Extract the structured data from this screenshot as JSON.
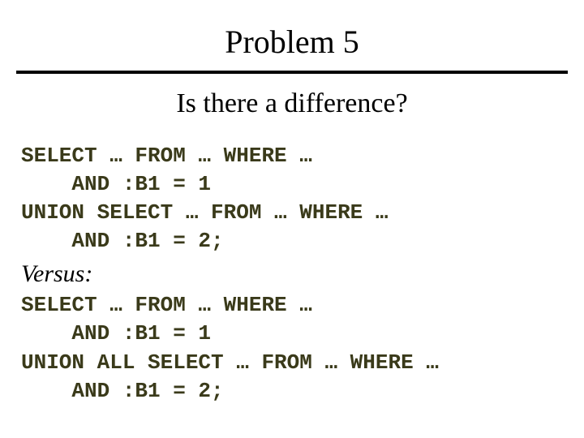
{
  "title": "Problem 5",
  "subtitle": "Is there a difference?",
  "code1": {
    "l1": "SELECT … FROM … WHERE …",
    "l2": "    AND :B1 = 1",
    "l3": "UNION SELECT … FROM … WHERE …",
    "l4": "    AND :B1 = 2;"
  },
  "versus": "Versus:",
  "code2": {
    "l1": "SELECT … FROM … WHERE …",
    "l2": "    AND :B1 = 1",
    "l3": "UNION ALL SELECT … FROM … WHERE …",
    "l4": "    AND :B1 = 2;"
  }
}
